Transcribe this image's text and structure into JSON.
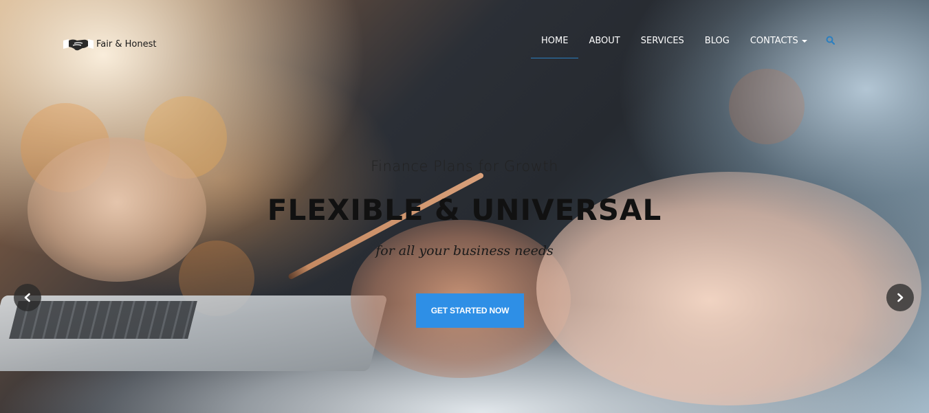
{
  "brand": {
    "name": "Fair & Honest",
    "logo_icon": "handshake-icon"
  },
  "nav": {
    "items": [
      {
        "label": "HOME",
        "active": true
      },
      {
        "label": "ABOUT",
        "active": false
      },
      {
        "label": "SERVICES",
        "active": false
      },
      {
        "label": "BLOG",
        "active": false
      },
      {
        "label": "CONTACTS",
        "active": false,
        "dropdown": true
      }
    ],
    "search_icon": "search-icon",
    "active_underline_color": "#2b7fc0",
    "search_icon_color": "#2b7fc0"
  },
  "hero": {
    "subtitle": "Finance Plans for Growth",
    "headline": "FLEXIBLE & UNIVERSAL",
    "tagline": "for all your business needs",
    "cta_label": "GET STARTED NOW",
    "cta_color": "#2e8fe6",
    "prev_icon": "chevron-left-icon",
    "next_icon": "chevron-right-icon"
  }
}
